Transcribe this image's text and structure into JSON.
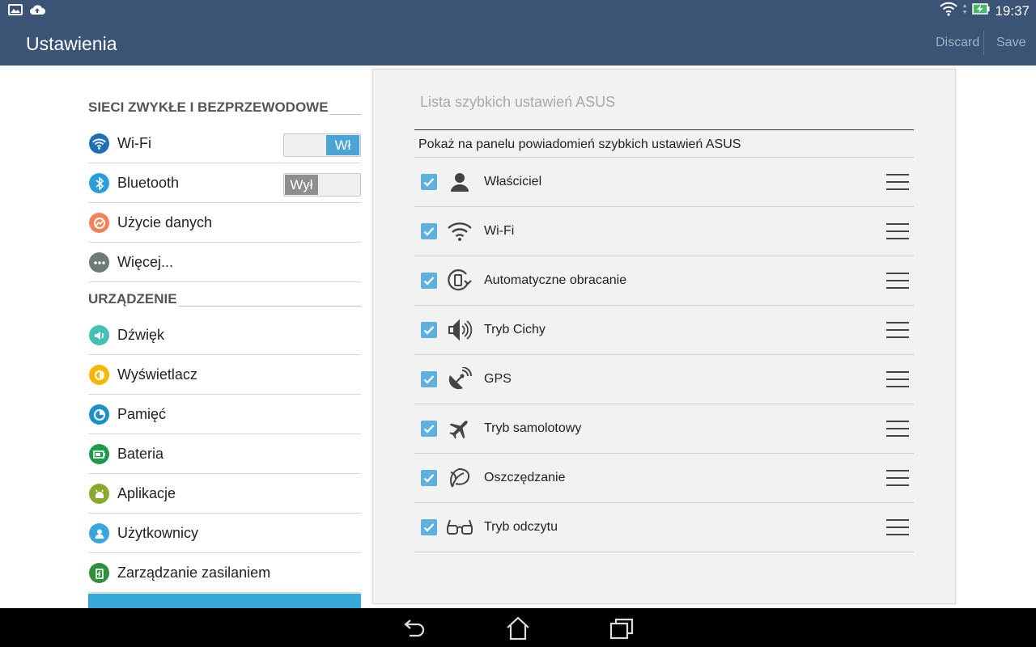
{
  "status_bar": {
    "time": "19:37",
    "left_icons": [
      "gallery-icon",
      "cloud-upload-icon"
    ],
    "right_icons": [
      "wifi-icon",
      "battery-charging-icon"
    ]
  },
  "action_bar": {
    "title": "Ustawienia",
    "discard_label": "Discard",
    "save_label": "Save"
  },
  "settings": {
    "sections": [
      {
        "header": "SIECI ZWYKŁE I BEZPRZEWODOWE",
        "items": [
          {
            "label": "Wi-Fi",
            "icon": "wifi-icon",
            "color": "#1f6fb2",
            "toggle": "Wł"
          },
          {
            "label": "Bluetooth",
            "icon": "bluetooth-icon",
            "color": "#2a9ed6",
            "toggle": "Wył"
          },
          {
            "label": "Użycie danych",
            "icon": "data-usage-icon",
            "color": "#f0835a"
          },
          {
            "label": "Więcej...",
            "icon": "more-icon",
            "color": "#6f7a74"
          }
        ]
      },
      {
        "header": "URZĄDZENIE",
        "items": [
          {
            "label": "Dźwięk",
            "icon": "sound-icon",
            "color": "#44c1b5"
          },
          {
            "label": "Wyświetlacz",
            "icon": "display-icon",
            "color": "#f5b800"
          },
          {
            "label": "Pamięć",
            "icon": "storage-icon",
            "color": "#1b8fc8"
          },
          {
            "label": "Bateria",
            "icon": "battery-icon",
            "color": "#1e9a4b"
          },
          {
            "label": "Aplikacje",
            "icon": "apps-icon",
            "color": "#8aaa2d"
          },
          {
            "label": "Użytkownicy",
            "icon": "users-icon",
            "color": "#3aa6de"
          },
          {
            "label": "Zarządzanie zasilaniem",
            "icon": "power-management-icon",
            "color": "#2f8f3e"
          }
        ]
      }
    ]
  },
  "panel": {
    "title": "Lista szybkich ustawień ASUS",
    "description": "Pokaż na panelu powiadomień szybkich ustawień ASUS",
    "items": [
      {
        "label": "Właściciel",
        "icon": "owner-icon",
        "checked": true
      },
      {
        "label": "Wi-Fi",
        "icon": "wifi-icon",
        "checked": true
      },
      {
        "label": "Automatyczne obracanie",
        "icon": "auto-rotate-icon",
        "checked": true
      },
      {
        "label": "Tryb Cichy",
        "icon": "silent-mode-icon",
        "checked": true
      },
      {
        "label": "GPS",
        "icon": "gps-icon",
        "checked": true
      },
      {
        "label": "Tryb samolotowy",
        "icon": "airplane-icon",
        "checked": true
      },
      {
        "label": "Oszczędzanie",
        "icon": "power-saving-icon",
        "checked": true
      },
      {
        "label": "Tryb odczytu",
        "icon": "reading-mode-icon",
        "checked": true
      }
    ]
  },
  "nav_bar": {
    "buttons": [
      "back-icon",
      "home-icon",
      "recents-icon"
    ]
  },
  "colors": {
    "header": "#3b5475",
    "accent": "#4aa4d6",
    "checkbox": "#5fb0dc",
    "panel_bg": "#f2f2f2"
  }
}
